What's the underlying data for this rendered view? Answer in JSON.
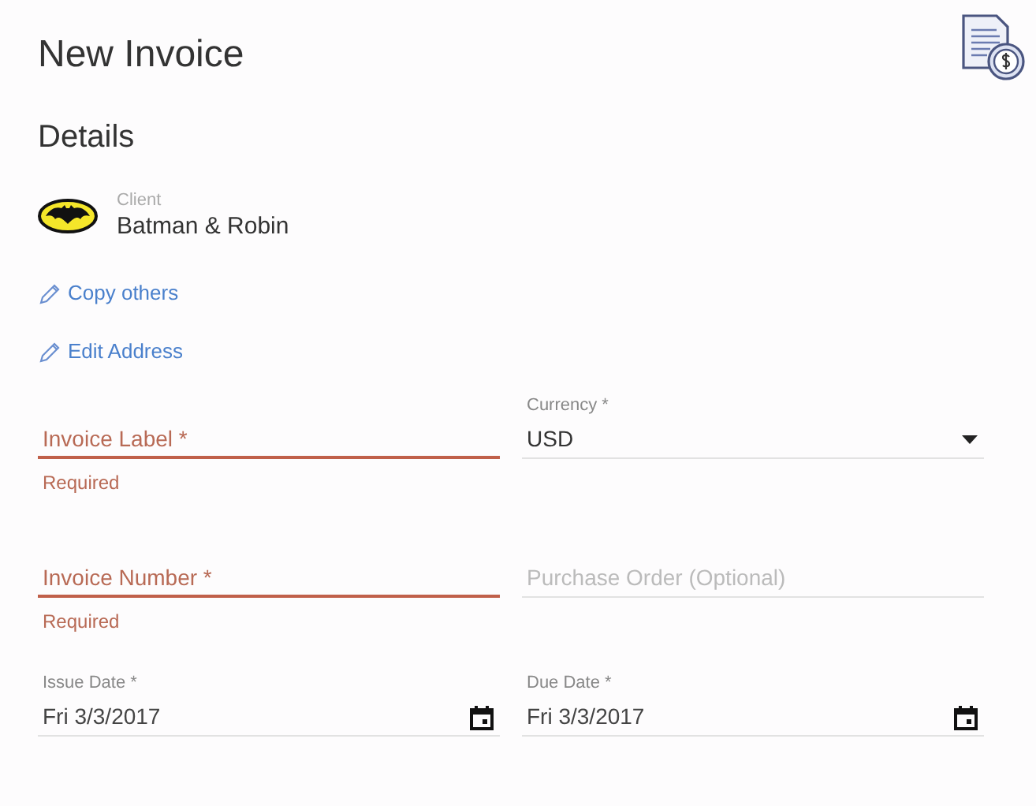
{
  "title": "New Invoice",
  "section": "Details",
  "client": {
    "label": "Client",
    "name": "Batman & Robin"
  },
  "links": [
    {
      "label": "Copy others"
    },
    {
      "label": "Edit Address"
    }
  ],
  "columns": [
    {
      "fields": [
        {
          "kind": "text",
          "label": "Invoice Label *",
          "error": "Required"
        },
        {
          "kind": "text",
          "label": "Invoice Number *",
          "error": "Required"
        },
        {
          "kind": "date",
          "label": "Issue Date *",
          "value": "Fri 3/3/2017"
        }
      ]
    },
    {
      "fields": [
        {
          "kind": "select",
          "label": "Currency *",
          "value": "USD"
        },
        {
          "kind": "text",
          "placeholder": "Purchase Order (Optional)"
        },
        {
          "kind": "date",
          "label": "Due Date *",
          "value": "Fri 3/3/2017"
        }
      ]
    }
  ]
}
